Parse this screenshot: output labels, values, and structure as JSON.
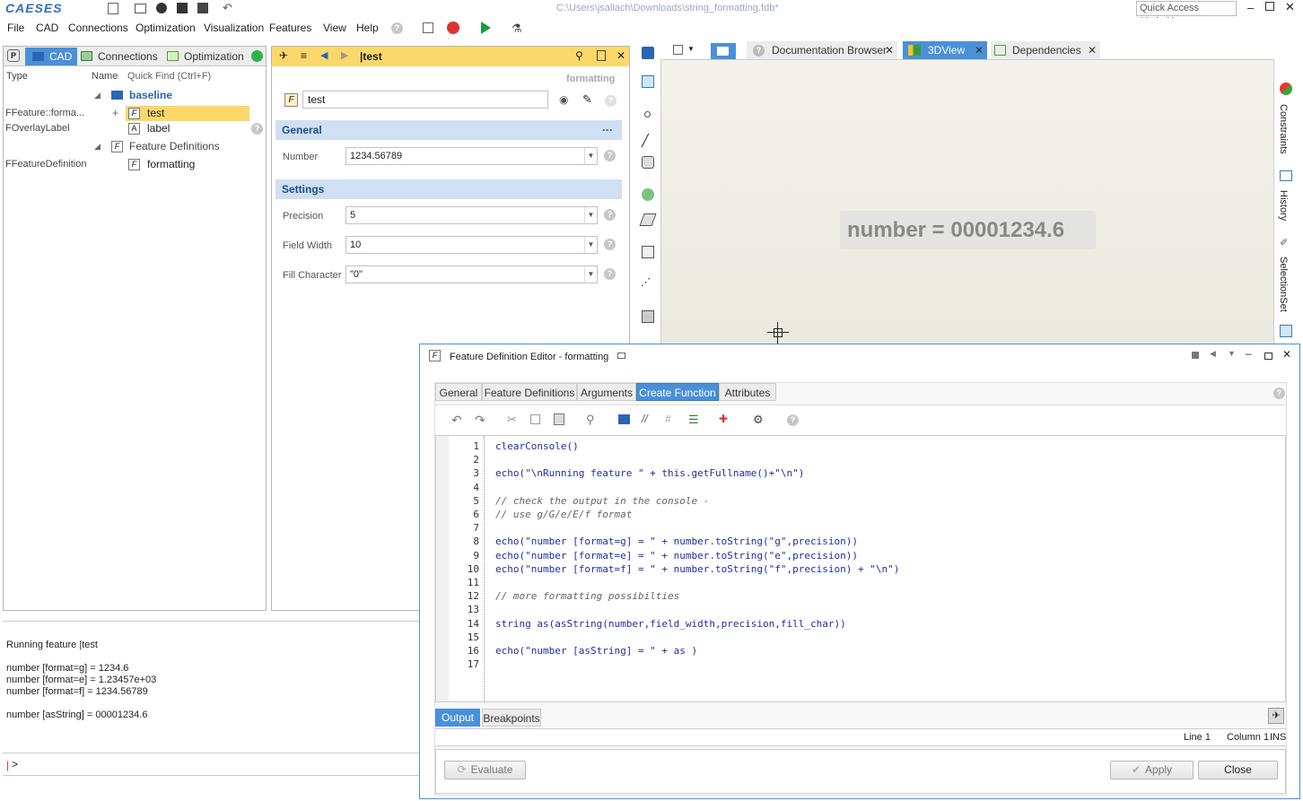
{
  "app": {
    "logo": "CAESES",
    "file_path": "C:\\Users\\jsallach\\Downloads\\string_formatting.fdb*",
    "quick_access_placeholder": "Quick Access (Ctrl+Q)"
  },
  "menu": [
    "File",
    "CAD",
    "Connections",
    "Optimization",
    "Visualization",
    "Features",
    "View",
    "Help"
  ],
  "left_panel": {
    "tabs": [
      "CAD",
      "Connections",
      "Optimization"
    ],
    "columns": {
      "type": "Type",
      "name": "Name",
      "quick_find": "Quick Find (Ctrl+F)"
    },
    "rows": [
      {
        "type": "",
        "name": "baseline"
      },
      {
        "type": "FFeature::forma...",
        "name": "test"
      },
      {
        "type": "FOverlayLabel",
        "name": "label"
      },
      {
        "type": "",
        "name": "Feature Definitions"
      },
      {
        "type": "FFeatureDefinition",
        "name": "formatting"
      }
    ]
  },
  "middle_panel": {
    "header_title": "|test",
    "definition": "formatting",
    "name_value": "test",
    "general": {
      "title": "General",
      "number_label": "Number",
      "number_value": "1234.56789"
    },
    "settings": {
      "title": "Settings",
      "precision_label": "Precision",
      "precision_value": "5",
      "fieldwidth_label": "Field Width",
      "fieldwidth_value": "10",
      "fillchar_label": "Fill Character",
      "fillchar_value": "\"0\""
    }
  },
  "view_tabs": [
    "Documentation Browser",
    "3DView",
    "Dependencies"
  ],
  "viewport_label": "number = 00001234.6",
  "side_tabs": [
    "Constraints",
    "History",
    "SelectionSet"
  ],
  "console": {
    "lines": [
      "Running feature |test",
      "",
      "number [format=g] = 1234.6",
      "number [format=e] = 1.23457e+03",
      "number [format=f] = 1234.56789",
      "",
      "number [asString] = 00001234.6"
    ],
    "prompt": ">"
  },
  "editor": {
    "title": "Feature Definition Editor - formatting",
    "tabs": [
      "General",
      "Feature Definitions",
      "Arguments",
      "Create Function",
      "Attributes"
    ],
    "active_tab": "Create Function",
    "code": [
      {
        "n": "1",
        "t": "clearConsole()",
        "c": false
      },
      {
        "n": "2",
        "t": "",
        "c": false
      },
      {
        "n": "3",
        "t": "echo(\"\\nRunning feature \" + this.getFullname()+\"\\n\")",
        "c": false
      },
      {
        "n": "4",
        "t": "",
        "c": false
      },
      {
        "n": "5",
        "t": "// check the output in the console -",
        "c": true
      },
      {
        "n": "6",
        "t": "// use g/G/e/E/f format",
        "c": true
      },
      {
        "n": "7",
        "t": "",
        "c": false
      },
      {
        "n": "8",
        "t": "echo(\"number [format=g] = \" + number.toString(\"g\",precision))",
        "c": false
      },
      {
        "n": "9",
        "t": "echo(\"number [format=e] = \" + number.toString(\"e\",precision))",
        "c": false
      },
      {
        "n": "10",
        "t": "echo(\"number [format=f] = \" + number.toString(\"f\",precision) + \"\\n\")",
        "c": false
      },
      {
        "n": "11",
        "t": "",
        "c": false
      },
      {
        "n": "12",
        "t": "// more formatting possibilties",
        "c": true
      },
      {
        "n": "13",
        "t": "",
        "c": false
      },
      {
        "n": "14",
        "t": "string as(asString(number,field_width,precision,fill_char))",
        "c": false
      },
      {
        "n": "15",
        "t": "",
        "c": false
      },
      {
        "n": "16",
        "t": "echo(\"number [asString] = \" + as )",
        "c": false
      },
      {
        "n": "17",
        "t": "",
        "c": false
      }
    ],
    "bottom_tabs": [
      "Output",
      "Breakpoints"
    ],
    "status": {
      "line": "Line 1",
      "column": "Column 1",
      "mode": "INS"
    },
    "buttons": {
      "evaluate": "Evaluate",
      "apply": "Apply",
      "close": "Close"
    }
  }
}
